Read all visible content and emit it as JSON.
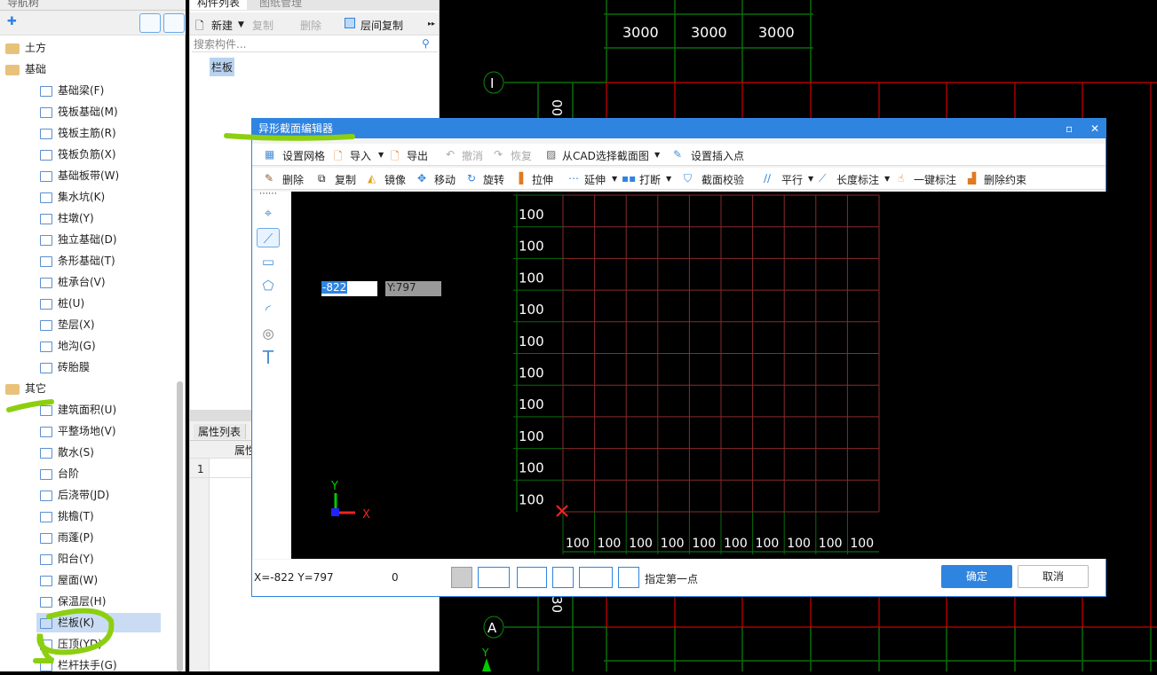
{
  "nav": {
    "header": "导航树",
    "groups": [
      {
        "label": "土方",
        "items": []
      },
      {
        "label": "基础",
        "items": [
          "基础梁(F)",
          "筏板基础(M)",
          "筏板主筋(R)",
          "筏板负筋(X)",
          "基础板带(W)",
          "集水坑(K)",
          "柱墩(Y)",
          "独立基础(D)",
          "条形基础(T)",
          "桩承台(V)",
          "桩(U)",
          "垫层(X)",
          "地沟(G)",
          "砖胎膜"
        ]
      },
      {
        "label": "其它",
        "items": [
          "建筑面积(U)",
          "平整场地(V)",
          "散水(S)",
          "台阶",
          "后浇带(JD)",
          "挑檐(T)",
          "雨蓬(P)",
          "阳台(Y)",
          "屋面(W)",
          "保温层(H)",
          "栏板(K)",
          "压顶(YD)",
          "栏杆扶手(G)"
        ]
      }
    ],
    "selected": "栏板(K)"
  },
  "mid": {
    "tabs": [
      "构件列表",
      "图纸管理"
    ],
    "toolbar": {
      "new": "新建",
      "copy": "复制",
      "delete": "删除",
      "floor_copy": "层间复制"
    },
    "search_placeholder": "搜索构件...",
    "list": [
      "栏板"
    ],
    "prop_tab": "属性列表",
    "prop_header": "属性",
    "prop_row": "1"
  },
  "cad": {
    "dims_top": [
      "3000",
      "3000",
      "3000"
    ],
    "axis_I": "I",
    "axis_A": "A",
    "left_dim_top": "00",
    "left_dim_bottom": "30",
    "y_label": "Y"
  },
  "dialog": {
    "title": "异形截面编辑器",
    "toolbar1": {
      "grid": "设置网格",
      "import": "导入",
      "export": "导出",
      "undo": "撤消",
      "redo": "恢复",
      "from_cad": "从CAD选择截面图",
      "insert_point": "设置插入点"
    },
    "toolbar2": {
      "delete": "删除",
      "copy": "复制",
      "mirror": "镜像",
      "move": "移动",
      "rotate": "旋转",
      "stretch": "拉伸",
      "extend": "延伸",
      "break": "打断",
      "check": "截面校验",
      "parallel": "平行",
      "length_dim": "长度标注",
      "one_key_dim": "一键标注",
      "delete_constraint": "删除约束"
    },
    "canvas": {
      "x_input": "-822",
      "y_display": "Y:797",
      "grid_spacing_label": "100",
      "rows": 10,
      "cols": 10,
      "axis_x": "X",
      "axis_y": "Y"
    },
    "status": {
      "coords": "X=-822 Y=797",
      "value": "0",
      "prompt": "指定第一点"
    },
    "ok": "确定",
    "cancel": "取消"
  }
}
